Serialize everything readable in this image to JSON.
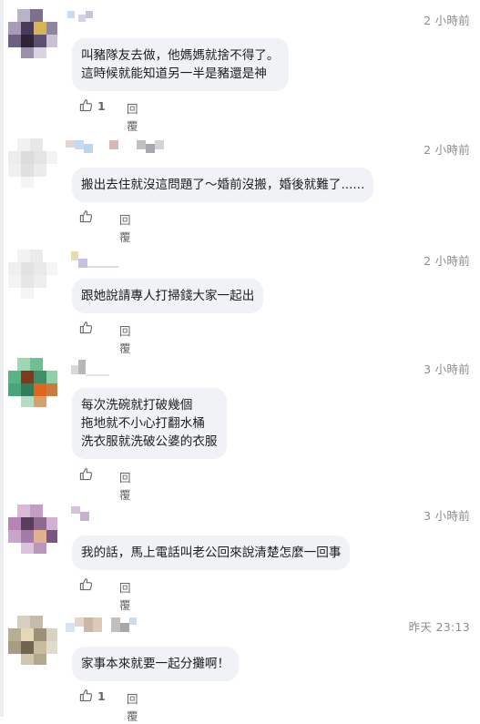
{
  "colors": {
    "bubble": "#f0f2f5",
    "meta_text": "#8a8d91",
    "action_text": "#65676b",
    "body_text": "#1c1e21"
  },
  "icons": {
    "like": "thumbs-up-outline-icon"
  },
  "comments": [
    {
      "author_name": "(pixelated)",
      "time": "2 小時前",
      "lines": [
        "叫豬隊友去做，他媽媽就捨不得了。",
        "這時候就能知道另一半是豬還是神"
      ],
      "like_count": "1",
      "reply_label": "回覆"
    },
    {
      "author_name": "(pixelated)",
      "time": "2 小時前",
      "lines": [
        "搬出去住就沒這問題了～婚前沒搬，婚後就難了......"
      ],
      "like_count": "",
      "reply_label": "回覆"
    },
    {
      "author_name": "(pixelated)",
      "time": "2 小時前",
      "lines": [
        "跟她說請專人打掃錢大家一起出"
      ],
      "like_count": "",
      "reply_label": "回覆"
    },
    {
      "author_name": "(pixelated)",
      "time": "3 小時前",
      "lines": [
        "每次洗碗就打破幾個",
        "拖地就不小心打翻水桶",
        "洗衣服就洗破公婆的衣服"
      ],
      "like_count": "",
      "reply_label": "回覆"
    },
    {
      "author_name": "(pixelated)",
      "time": "3 小時前",
      "lines": [
        "我的話，馬上電話叫老公回來說清楚怎麼一回事"
      ],
      "like_count": "",
      "reply_label": "回覆"
    },
    {
      "author_name": "(pixelated)",
      "time": "昨天 23:13",
      "lines": [
        "家事本來就要一起分攤啊！"
      ],
      "like_count": "1",
      "reply_label": "回覆"
    }
  ]
}
